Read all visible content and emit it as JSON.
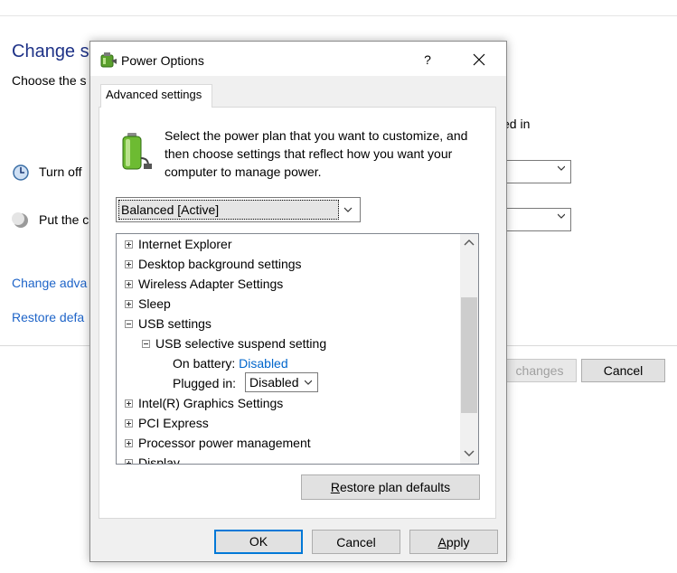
{
  "background": {
    "title": "Change se",
    "subtitle": "Choose the s",
    "partial_text": "ed in",
    "rows": [
      {
        "label": "Turn off",
        "icon": "display-icon"
      },
      {
        "label": "Put the c",
        "icon": "sleep-moon-icon"
      }
    ],
    "links": [
      "Change adva",
      "Restore defa"
    ],
    "save_label": "changes",
    "cancel_label": "Cancel"
  },
  "dialog": {
    "title": "Power Options",
    "help_label": "?",
    "tab_label": "Advanced settings",
    "intro": "Select the power plan that you want to customize, and then choose settings that reflect how you want your computer to manage power.",
    "plan_select_value": "Balanced [Active]",
    "tree_items": [
      {
        "label": "Internet Explorer",
        "expander": "plus"
      },
      {
        "label": "Desktop background settings",
        "expander": "plus"
      },
      {
        "label": "Wireless Adapter Settings",
        "expander": "plus"
      },
      {
        "label": "Sleep",
        "expander": "plus"
      },
      {
        "label": "USB settings",
        "expander": "minus"
      },
      {
        "label": "USB selective suspend setting",
        "expander": "minus"
      },
      {
        "label": "Intel(R) Graphics Settings",
        "expander": "plus"
      },
      {
        "label": "PCI Express",
        "expander": "plus"
      },
      {
        "label": "Processor power management",
        "expander": "plus"
      },
      {
        "label": "Display",
        "expander": "plus"
      }
    ],
    "on_battery_label": "On battery:",
    "on_battery_value": "Disabled",
    "plugged_in_label": "Plugged in:",
    "plugged_in_value": "Disabled",
    "restore_button": {
      "key": "R",
      "rest": "estore plan defaults"
    },
    "ok_label": "OK",
    "cancel_label": "Cancel",
    "apply_button": {
      "key": "A",
      "rest": "pply"
    }
  },
  "colors": {
    "heading_blue": "#1e3287",
    "link_blue": "#0066cc",
    "default_button_border": "#0078d7"
  }
}
